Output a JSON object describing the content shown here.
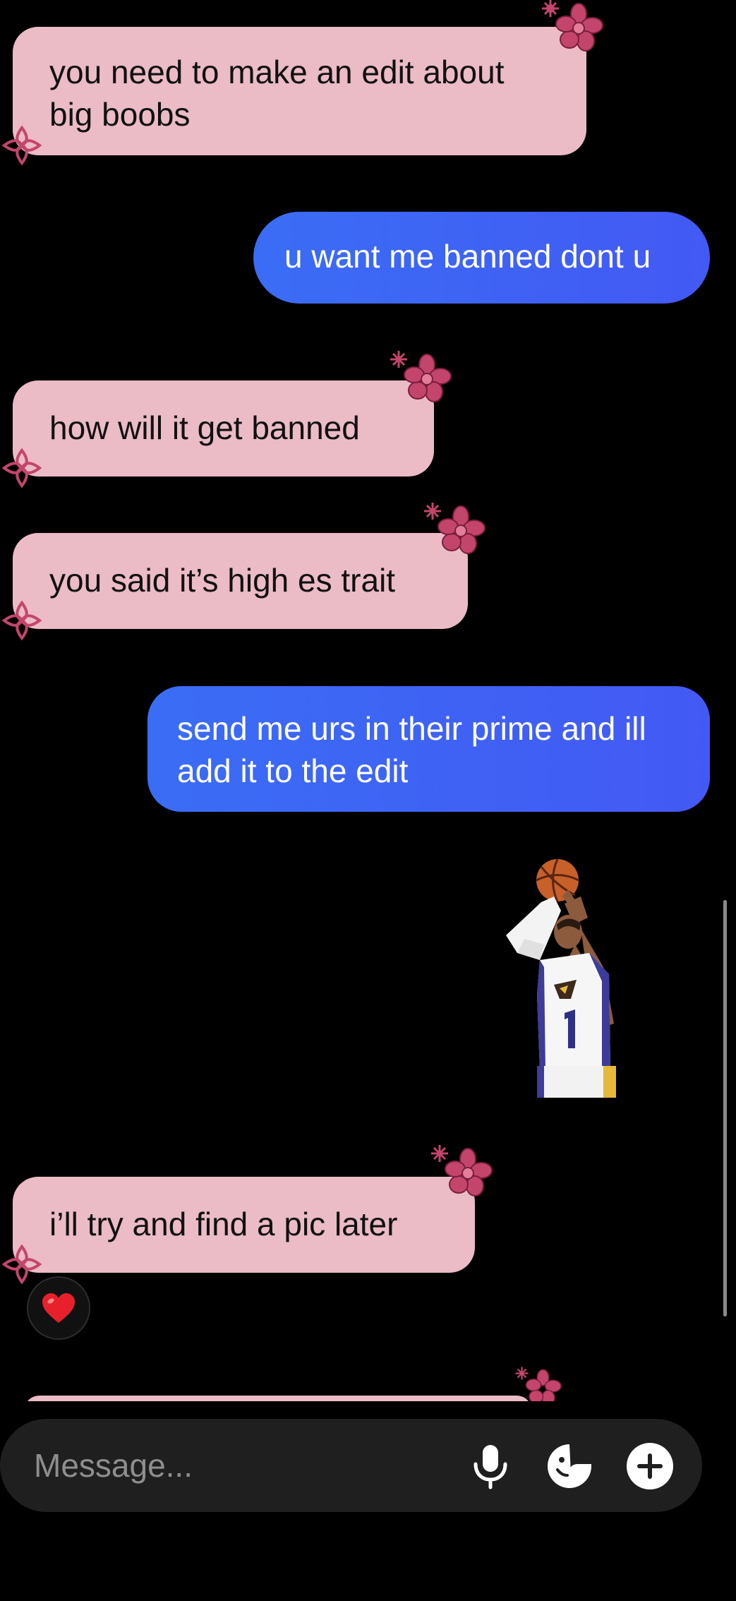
{
  "colors": {
    "incoming_bubble": "#ebbbc6",
    "outgoing_bubble": "#4160f4",
    "background": "#000000",
    "flower": "#c4456c"
  },
  "messages": [
    {
      "sender": "them",
      "text": "you need to make an edit about big boobs",
      "decoration": "pink-flower-icon"
    },
    {
      "sender": "me",
      "text": "u want me banned dont u"
    },
    {
      "sender": "them",
      "text": "how will it get banned",
      "decoration": "pink-flower-icon"
    },
    {
      "sender": "them",
      "text": "you said it’s high es trait",
      "decoration": "pink-flower-icon"
    },
    {
      "sender": "me",
      "text": "send me urs in their prime and ill add it to the edit"
    },
    {
      "sender": "me",
      "type": "sticker",
      "sticker": "basketball-player-sticker"
    },
    {
      "sender": "them",
      "text": "i’ll try and find a pic later",
      "decoration": "pink-flower-icon",
      "reaction": "❤️"
    }
  ],
  "composer": {
    "placeholder": "Message...",
    "icons": [
      "microphone-icon",
      "sticker-icon",
      "plus-icon"
    ]
  }
}
